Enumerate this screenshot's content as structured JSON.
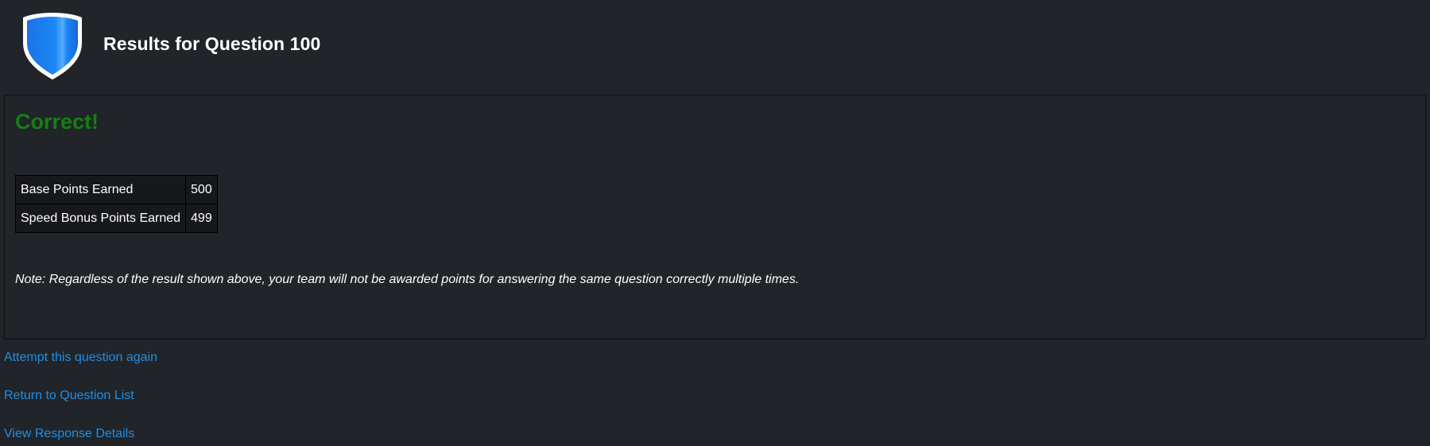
{
  "header": {
    "title": "Results for Question 100",
    "logo_icon": "shield-icon"
  },
  "result": {
    "status": "Correct!",
    "status_color": "#128012",
    "points": [
      {
        "label": "Base Points Earned",
        "value": "500"
      },
      {
        "label": "Speed Bonus Points Earned",
        "value": "499"
      }
    ],
    "note": "Note: Regardless of the result shown above, your team will not be awarded points for answering the same question correctly multiple times."
  },
  "links": {
    "attempt_again": "Attempt this question again",
    "return_list": "Return to Question List",
    "view_details": "View Response Details"
  },
  "colors": {
    "background": "#212428",
    "link": "#1e8fe6",
    "shield_blue": "#1e7ff0"
  }
}
